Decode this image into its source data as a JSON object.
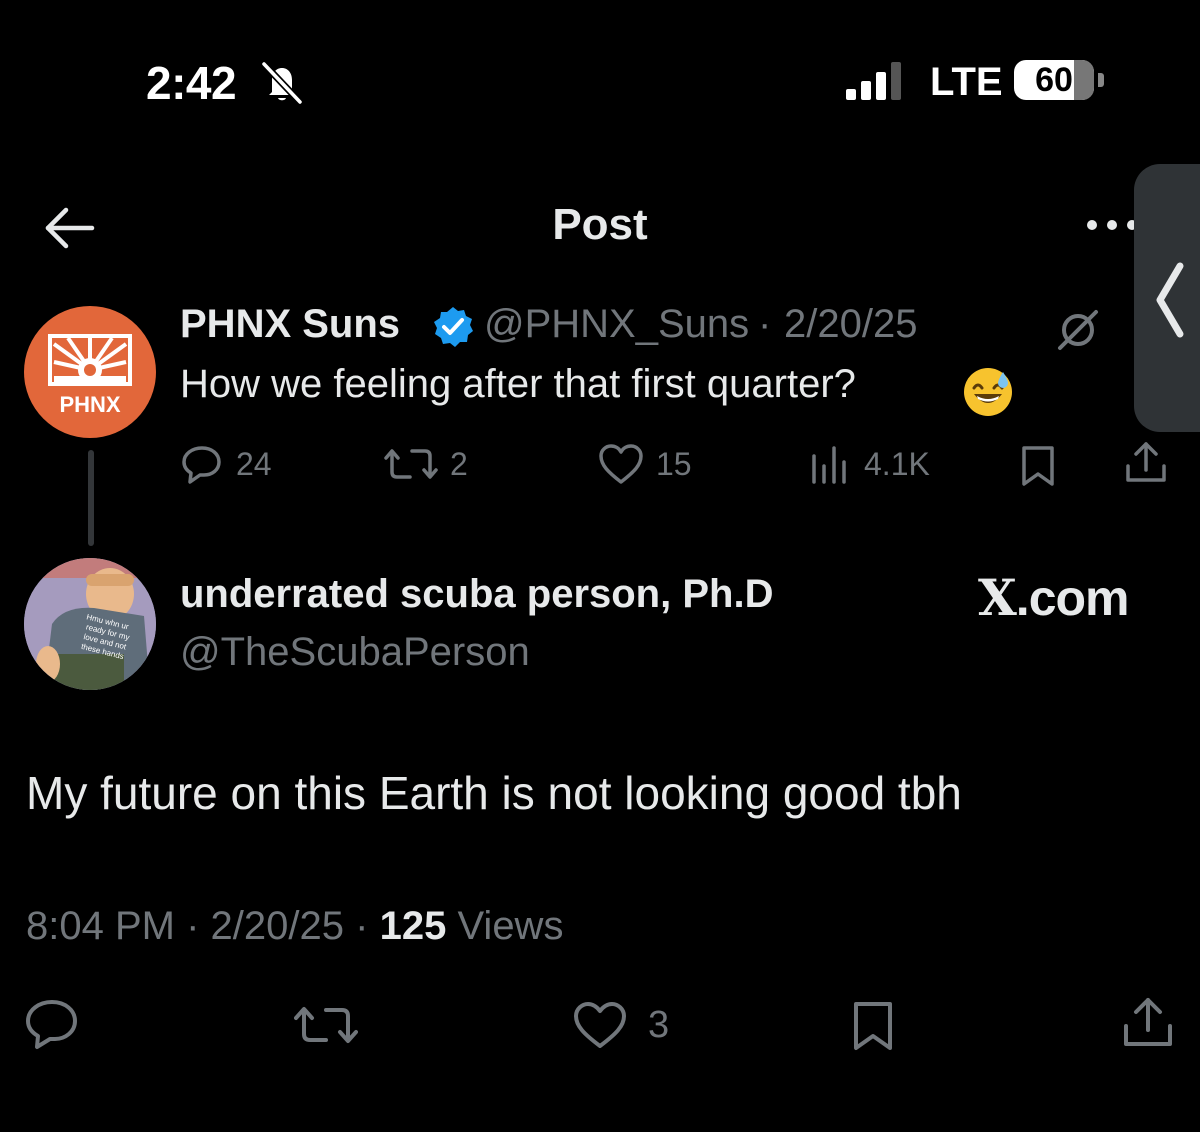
{
  "status_bar": {
    "time": "2:42",
    "network": "LTE",
    "battery": "60"
  },
  "header": {
    "title": "Post"
  },
  "parent_tweet": {
    "avatar_text": "PHNX",
    "name": "PHNX Suns",
    "handle": "@PHNX_Suns",
    "separator": "·",
    "date": "2/20/25",
    "text": "How we feeling after that first quarter?",
    "emoji": "sweat-smile",
    "metrics": {
      "replies": "24",
      "reposts": "2",
      "likes": "15",
      "views": "4.1K"
    }
  },
  "reply": {
    "name": "underrated scuba person, Ph.D",
    "handle": "@TheScubaPerson",
    "text": "My future on this Earth is not looking good tbh",
    "time": "8:04 PM",
    "date": "2/20/25",
    "views_count": "125",
    "views_label": "Views",
    "likes": "3"
  },
  "watermark": {
    "x_letter": "X",
    "suffix": ".com"
  },
  "colors": {
    "background": "#000000",
    "text_primary": "#e7e9ea",
    "text_secondary": "#71767b",
    "verified_blue": "#1d9bf0",
    "avatar_orange": "#e2673a"
  },
  "icons": [
    "back-arrow-icon",
    "more-icon",
    "verified-icon",
    "grok-icon",
    "reply-icon",
    "repost-icon",
    "like-icon",
    "views-icon",
    "bookmark-icon",
    "share-icon",
    "bell-off-icon",
    "signal-icon",
    "battery-icon"
  ]
}
